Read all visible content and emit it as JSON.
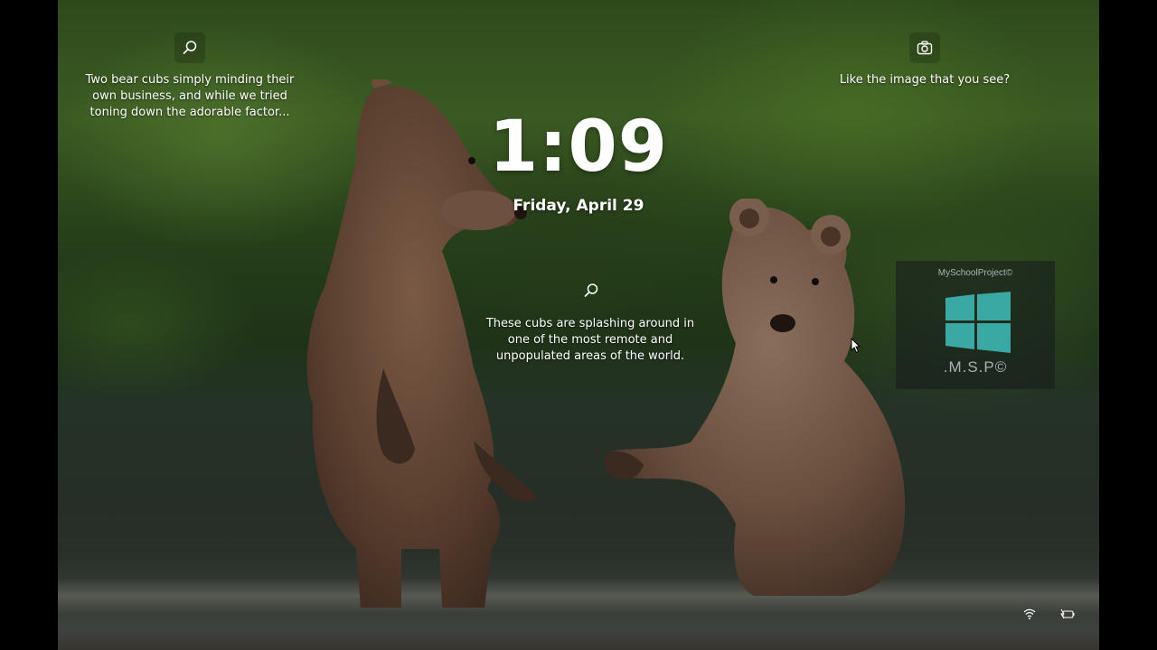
{
  "lock_screen": {
    "time": "1:09",
    "date": "Friday, April 29"
  },
  "spotlight": {
    "left_hotspot": {
      "icon": "search-icon",
      "text_lines": [
        "Two bear cubs simply minding their",
        "own business, and while we tried",
        "toning down the adorable factor..."
      ]
    },
    "center_hotspot": {
      "icon": "search-icon",
      "text_lines": [
        "These cubs are splashing around in",
        "one of the most remote and",
        "unpopulated areas of the world."
      ]
    },
    "right_prompt": {
      "icon": "camera-icon",
      "text": "Like the image that you see?"
    }
  },
  "watermark": {
    "title": "MySchoolProject©",
    "subtitle": ".M.S.P©",
    "logo_color": "#3aa9a4"
  },
  "tray": {
    "icons": [
      "wifi-icon",
      "battery-icon"
    ]
  }
}
